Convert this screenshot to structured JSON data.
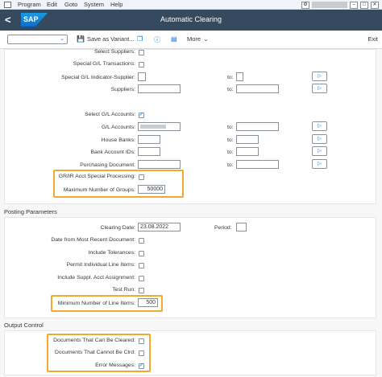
{
  "menubar": {
    "items": [
      "Program",
      "Edit",
      "Goto",
      "System",
      "Help"
    ],
    "window_controls": [
      "–",
      "□",
      "✕"
    ]
  },
  "header": {
    "logo": "SAP",
    "title": "Automatic Clearing",
    "back_glyph": "<",
    "color": "#354a5f"
  },
  "toolbar": {
    "variant_value": "",
    "save_variant": "Save as Variant...",
    "more": "More",
    "exit": "Exit"
  },
  "selection": {
    "select_suppliers": "Select Suppliers:",
    "special_gl_transactions": "Special G/L Transactions:",
    "special_gl_indicator_supplier": "Special G/L Indicator-Supplier:",
    "suppliers": "Suppliers:",
    "to": "to:",
    "select_gl_accounts": "Select G/L Accounts:",
    "select_gl_accounts_checked": true,
    "gl_accounts": "G/L Accounts:",
    "house_banks": "House Banks:",
    "bank_account_ids": "Bank Account IDs:",
    "purchasing_document": "Purchasing Document:",
    "grir_special": "GR/IR Acct Special Processing:",
    "max_groups_label": "Maximum Number of Groups:",
    "max_groups_value": "50000"
  },
  "posting": {
    "heading": "Posting Parameters",
    "clearing_date_label": "Clearing Date:",
    "clearing_date_value": "23.08.2022",
    "period_label": "Period:",
    "date_from_recent": "Date from Most Recent Document:",
    "include_tolerances": "Include Tolerances:",
    "permit_individual": "Permit Individual Line Items:",
    "include_suppl": "Include Suppl. Acct Assignment:",
    "test_run": "Test Run:",
    "min_line_items_label": "Minimum Number of Line Items:",
    "min_line_items_value": "500"
  },
  "output": {
    "heading": "Output Control",
    "docs_can_be_cleared": "Documents That Can Be Cleared:",
    "docs_cannot_be_clrd": "Documents That Cannot Be Clrd:",
    "error_messages": "Error Messages:",
    "error_messages_checked": true
  },
  "highlight_color": "#f0ab2e"
}
